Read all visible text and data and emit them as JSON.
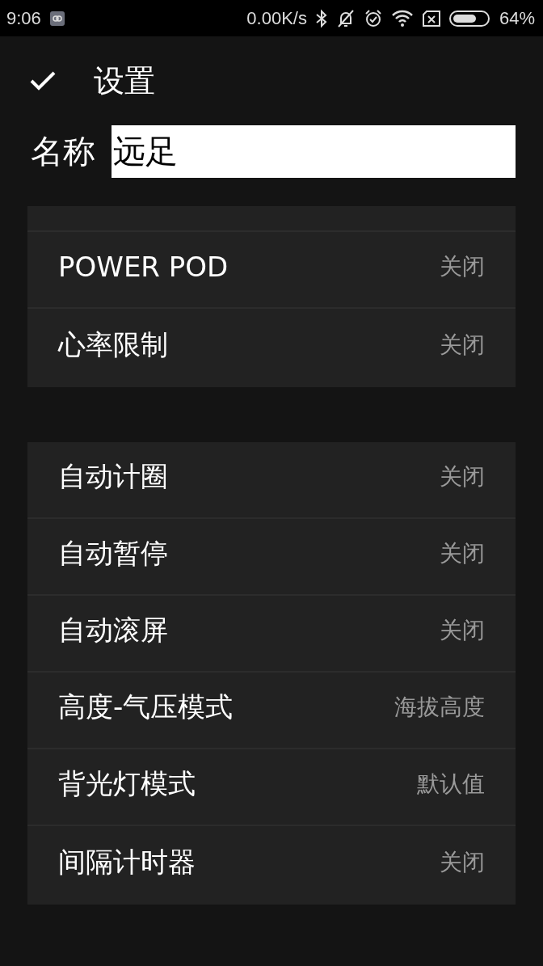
{
  "status_bar": {
    "time": "9:06",
    "speed": "0.00K/s",
    "battery": "64%"
  },
  "header": {
    "title": "设置"
  },
  "name_field": {
    "label": "名称",
    "value": "远足"
  },
  "groups": [
    {
      "items": [
        {
          "label": "POWER POD",
          "value": "关闭"
        },
        {
          "label": "心率限制",
          "value": "关闭"
        }
      ]
    },
    {
      "items": [
        {
          "label": "自动计圈",
          "value": "关闭"
        },
        {
          "label": "自动暂停",
          "value": "关闭"
        },
        {
          "label": "自动滚屏",
          "value": "关闭"
        },
        {
          "label": "高度-气压模式",
          "value": "海拔高度"
        },
        {
          "label": "背光灯模式",
          "value": "默认值"
        },
        {
          "label": "间隔计时器",
          "value": "关闭"
        }
      ]
    }
  ]
}
